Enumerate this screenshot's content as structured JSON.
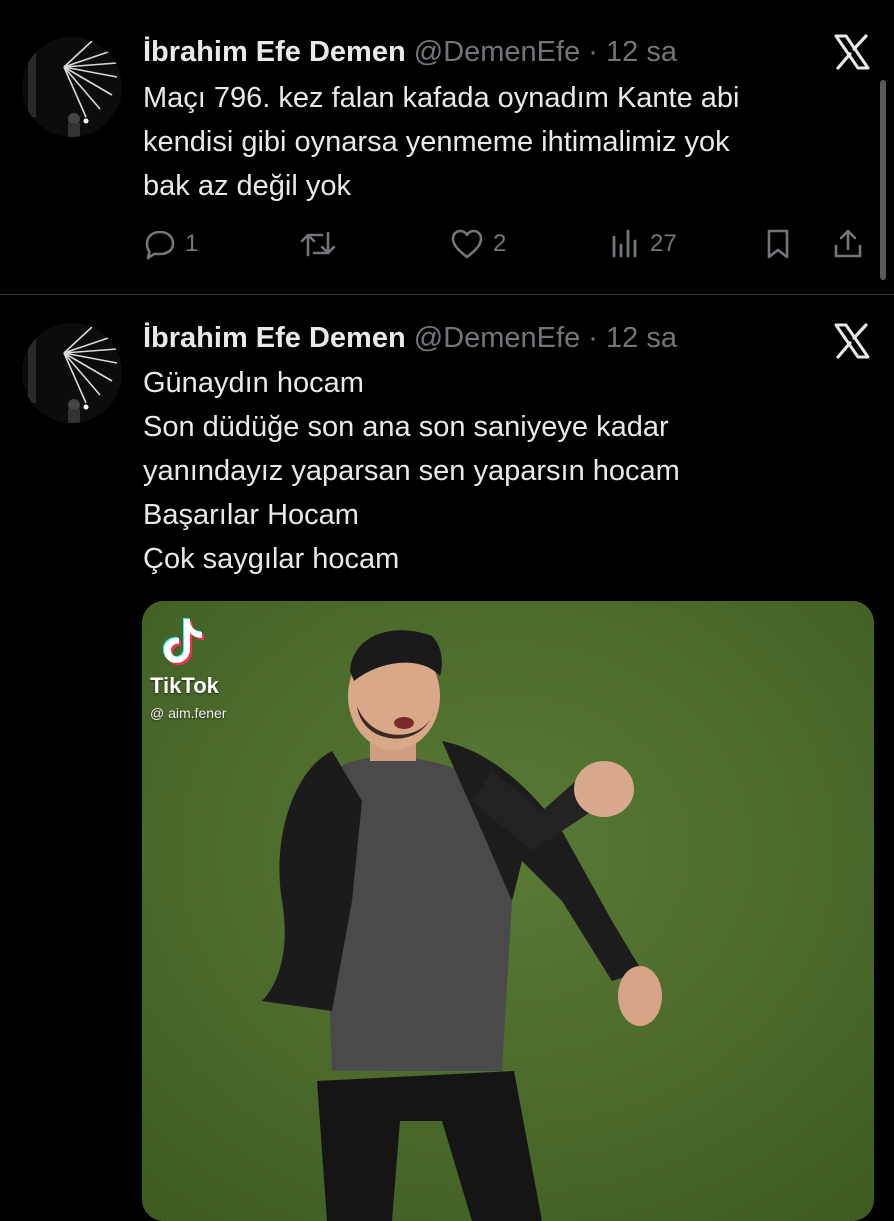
{
  "tweets": [
    {
      "author_name": "İbrahim Efe Demen",
      "handle": "@DemenEfe",
      "separator": "·",
      "time": "12 sa",
      "lines": [
        "Maçı 796. kez falan kafada oynadım Kante abi",
        "kendisi gibi oynarsa yenmeme ihtimalimiz yok",
        "bak az değil yok"
      ],
      "replies": "1",
      "likes": "2",
      "views": "27"
    },
    {
      "author_name": "İbrahim Efe Demen",
      "handle": "@DemenEfe",
      "separator": "·",
      "time": "12 sa",
      "lines": [
        "Günaydın hocam",
        "Son düdüğe son ana son saniyeye kadar",
        "yanındayız yaparsan sen yaparsın hocam",
        "Başarılar Hocam",
        "Çok saygılar hocam"
      ],
      "media": {
        "watermark_brand": "TikTok",
        "watermark_user": "@ aim.fener"
      }
    }
  ],
  "colors": {
    "background": "#000000",
    "primary_text": "#e7e9ea",
    "secondary_text": "#71767b",
    "divider": "#2f3336",
    "pitch_green": "#4c6b2c"
  },
  "icons": {
    "reply": "speech-bubble-icon",
    "retweet": "retweet-arrows-icon",
    "like": "heart-icon",
    "views": "bar-chart-icon",
    "bookmark": "bookmark-icon",
    "share": "share-upload-icon",
    "platform": "x-logo-icon"
  }
}
